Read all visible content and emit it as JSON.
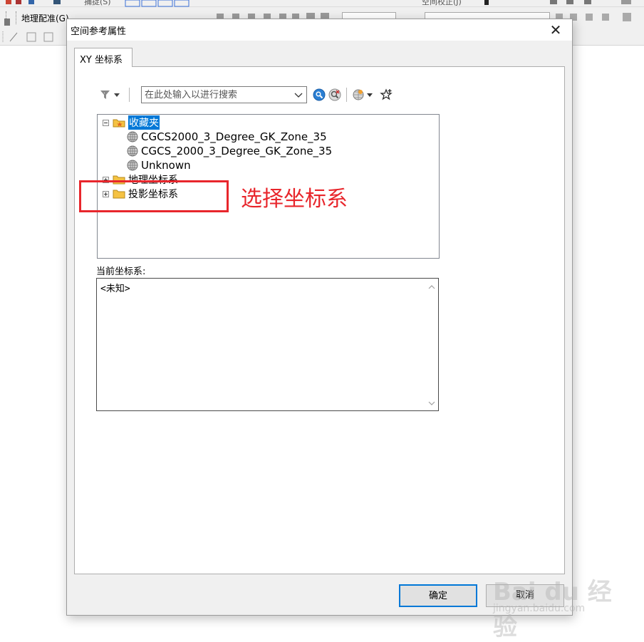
{
  "app_toolbar": {
    "capture_label": "捕捉(S)",
    "spatial_adjust_label": "空间校正(J)",
    "georef_label": "地理配准(G)"
  },
  "dialog": {
    "title": "空间参考属性",
    "close_glyph": "✕",
    "tab_label": "XY 坐标系"
  },
  "search": {
    "placeholder": "在此处输入以进行搜索"
  },
  "tree": {
    "items": [
      {
        "label": "收藏夹",
        "expander": "minus",
        "icon": "favorites-folder-icon",
        "selected": true
      },
      {
        "label": "CGCS2000_3_Degree_GK_Zone_35",
        "icon": "globe-icon"
      },
      {
        "label": "CGCS_2000_3_Degree_GK_Zone_35",
        "icon": "globe-icon"
      },
      {
        "label": "Unknown",
        "icon": "globe-icon"
      },
      {
        "label": "地理坐标系",
        "expander": "plus",
        "icon": "folder-icon"
      },
      {
        "label": "投影坐标系",
        "expander": "plus",
        "icon": "folder-icon"
      }
    ]
  },
  "annotation": {
    "text": "选择坐标系",
    "color": "#e8262c"
  },
  "current_cs": {
    "label": "当前坐标系:",
    "value": "<未知>"
  },
  "buttons": {
    "ok": "确定",
    "cancel": "取消"
  },
  "watermark": {
    "main": "Bai du 经验",
    "sub": "jingyan.baidu.com"
  },
  "colors": {
    "selection": "#0078d7",
    "accent_border": "#0078d7"
  }
}
